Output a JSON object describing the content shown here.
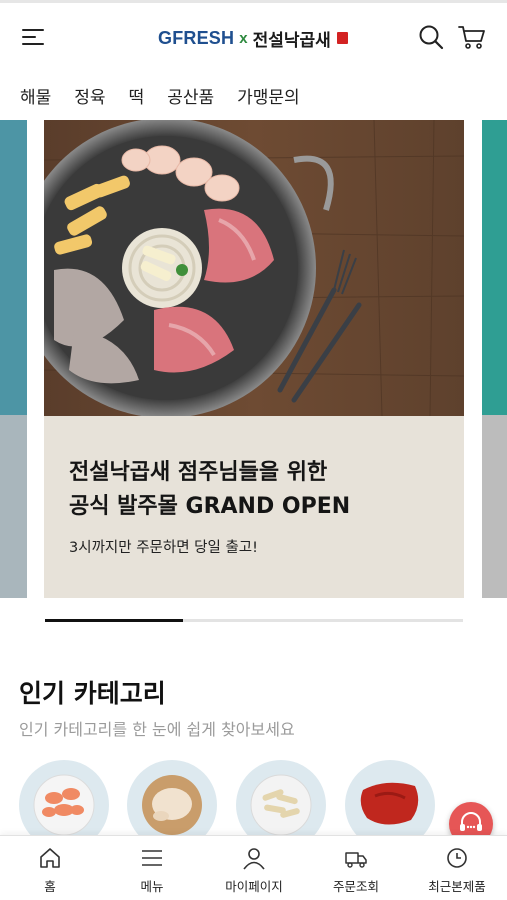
{
  "header": {
    "logo_primary": "GFRESH",
    "logo_separator": "x",
    "logo_brand": "전설낙곱새",
    "icons": {
      "menu": "hamburger-icon",
      "search": "search-icon",
      "cart": "cart-icon"
    },
    "colors": {
      "gfresh": "#1f4f8f",
      "x": "#2e8a3f",
      "seal": "#d32222"
    }
  },
  "categories": [
    "해물",
    "정육",
    "떡",
    "공산품",
    "가맹문의"
  ],
  "hero": {
    "title_line1": "전설낙곱새 점주님들을 위한",
    "title_line2": "공식 발주몰 GRAND OPEN",
    "subtitle": "3시까지만 주문하면 당일 출고!",
    "progress_fraction": 0.33,
    "caption_color": "#e7e2d9"
  },
  "popular": {
    "title": "인기 카테고리",
    "subtitle": "인기 카테고리를 한 눈에 쉽게 찾아보세요"
  },
  "chat": {
    "icon": "chat-support-icon",
    "color": "#e65656"
  },
  "tabbar": {
    "items": [
      {
        "label": "홈",
        "icon": "home-icon"
      },
      {
        "label": "메뉴",
        "icon": "menu-lines-icon"
      },
      {
        "label": "마이페이지",
        "icon": "user-icon"
      },
      {
        "label": "주문조회",
        "icon": "truck-icon"
      },
      {
        "label": "최근본제품",
        "icon": "clock-icon"
      }
    ]
  }
}
